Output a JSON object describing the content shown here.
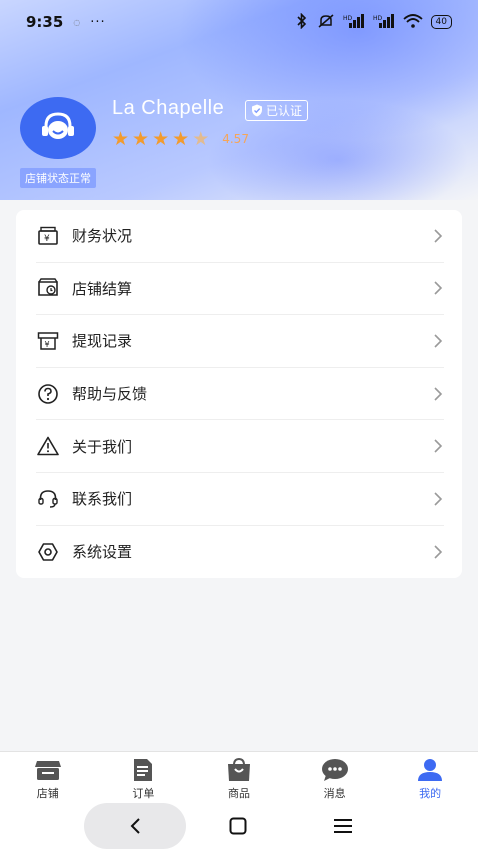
{
  "status_bar": {
    "time": "9:35",
    "dots": "···",
    "battery": "40"
  },
  "profile": {
    "shop_name": "La Chapelle",
    "verified_label": "已认证",
    "rating": "4.57",
    "stars_filled": 4,
    "stars_total": 5,
    "shop_status": "店铺状态正常"
  },
  "menu": {
    "items": [
      {
        "label": "财务状况",
        "icon": "finance-icon"
      },
      {
        "label": "店铺结算",
        "icon": "settlement-icon"
      },
      {
        "label": "提现记录",
        "icon": "withdraw-record-icon"
      },
      {
        "label": "帮助与反馈",
        "icon": "help-icon"
      },
      {
        "label": "关于我们",
        "icon": "warning-icon"
      },
      {
        "label": "联系我们",
        "icon": "headset-icon"
      },
      {
        "label": "系统设置",
        "icon": "settings-gear-icon"
      }
    ]
  },
  "tabs": [
    {
      "label": "店铺",
      "icon": "shop-icon"
    },
    {
      "label": "订单",
      "icon": "order-icon"
    },
    {
      "label": "商品",
      "icon": "goods-bag-icon"
    },
    {
      "label": "消息",
      "icon": "message-icon"
    },
    {
      "label": "我的",
      "icon": "user-icon",
      "active": true
    }
  ],
  "colors": {
    "accent": "#3d6af2",
    "star": "#f29b2e",
    "tab_inactive": "#555555"
  }
}
